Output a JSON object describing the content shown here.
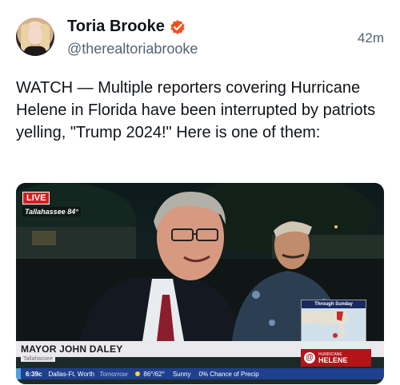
{
  "author": {
    "name": "Toria Brooke",
    "handle": "@therealtoriabrooke",
    "time": "42m"
  },
  "post": {
    "text": "WATCH — Multiple reporters covering Hurricane Helene in Florida have been interrupted by patriots yelling, \"Trump 2024!\" Here is one of them:"
  },
  "video": {
    "live": "LIVE",
    "location": "Tallahassee 84°",
    "mayor": "MAYOR JOHN DALEY",
    "city": "Tallahassee",
    "map_title": "Through Sunday",
    "hurricane_small": "HURRICANE",
    "hurricane_big": "HELENE",
    "ticker": {
      "time": "6:39c",
      "city": "Dallas-Ft. Worth",
      "tomorrow": "Tomorrow",
      "temps": "86°/62°",
      "sky": "Sunny",
      "precip": "0% Chance of Precip"
    }
  },
  "colors": {
    "verified": "#f4511e",
    "accent_red": "#b31418",
    "ticker_blue": "#1f3f8f"
  },
  "icons": {
    "verified": "verified-badge-icon",
    "hurricane": "hurricane-icon",
    "sun": "sun-icon"
  }
}
